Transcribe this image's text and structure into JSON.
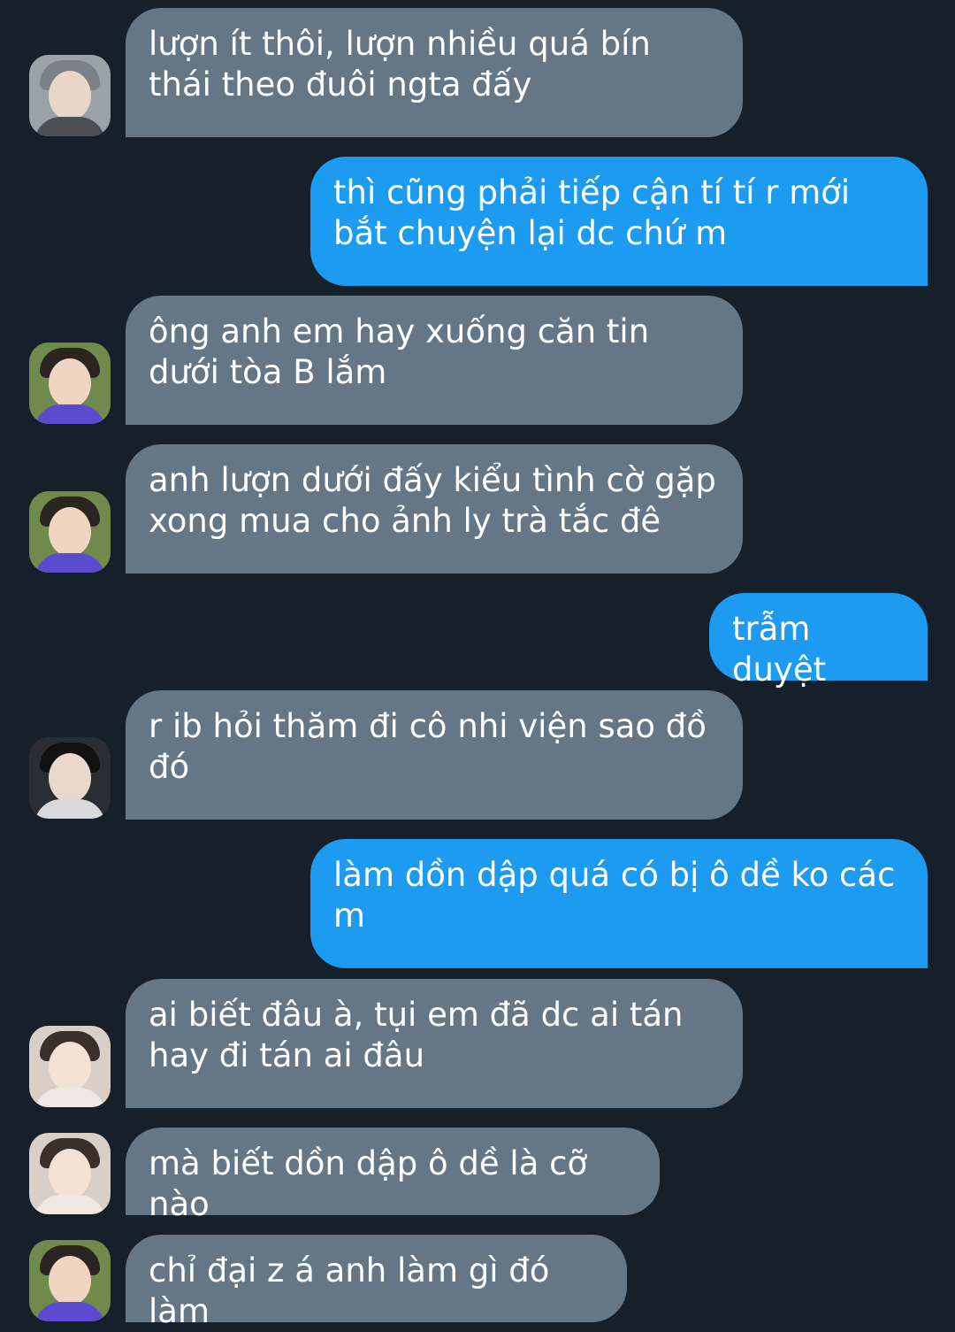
{
  "messages": [
    {
      "side": "in",
      "text": "lượn ít thôi, lượn nhiều quá bín thái theo đuôi ngta đấy",
      "avatar": "gray"
    },
    {
      "side": "out",
      "text": "thì cũng phải tiếp cận tí tí r mới bắt chuyện lại dc chứ m"
    },
    {
      "side": "in",
      "text": "ông anh em hay xuống căn tin dưới tòa B lắm",
      "avatar": "green"
    },
    {
      "side": "in",
      "text": "anh lượn dưới đấy kiểu tình cờ gặp xong mua cho ảnh ly trà tắc đê",
      "avatar": "green"
    },
    {
      "side": "out",
      "text": "trẫm duyệt"
    },
    {
      "side": "in",
      "text": "r ib hỏi thăm đi cô nhi viện sao đồ đó",
      "avatar": "dark"
    },
    {
      "side": "out",
      "text": "làm dồn dập quá có bị ô dề ko các m"
    },
    {
      "side": "in",
      "text": "ai biết đâu à, tụi em đã dc ai tán hay đi tán ai đâu",
      "avatar": "light"
    },
    {
      "side": "in",
      "text": "mà biết dồn dập ô dề là cỡ nào",
      "avatar": "light"
    },
    {
      "side": "in",
      "text": "chỉ đại z á anh làm gì đó làm",
      "avatar": "green"
    }
  ],
  "colors": {
    "background": "#15202b",
    "incoming_bubble": "#657786",
    "outgoing_bubble": "#1d9bf0",
    "text": "#ffffff"
  }
}
